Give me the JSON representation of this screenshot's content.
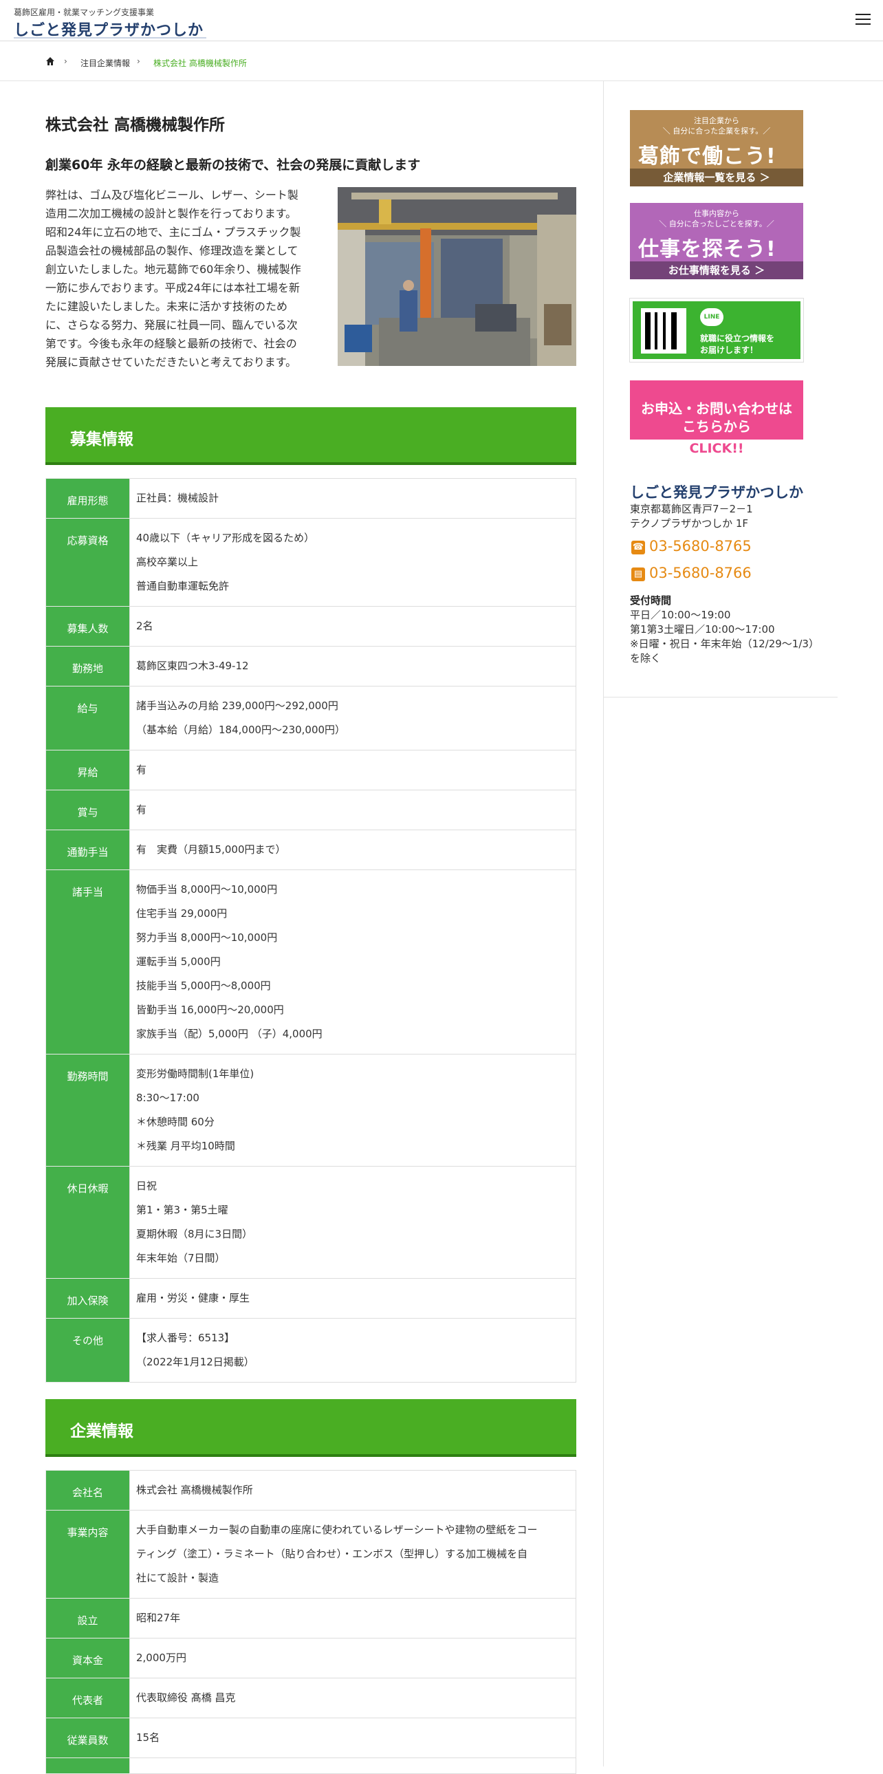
{
  "header": {
    "subtitle": "葛飾区雇用・就業マッチング支援事業",
    "logo": "しごと発見プラザかつしか"
  },
  "breadcrumb": {
    "items": [
      "注目企業情報"
    ],
    "current": "株式会社 高橋機械製作所"
  },
  "company": {
    "title": "株式会社 高橋機械製作所",
    "lead": "創業60年 永年の経験と最新の技術で、社会の発展に貢献します",
    "intro_lines": [
      "弊社は、ゴム及び塩化ビニール、レザー、シート製",
      "造用二次加工機械の設計と製作を行っております。",
      "昭和24年に立石の地で、主にゴム・プラスチック製",
      "品製造会社の機械部品の製作、修理改造を業として",
      "創立いたしました。地元葛飾で60年余り、機械製作",
      "一筋に歩んでおります。平成24年には本社工場を新",
      "たに建設いたしました。未来に活かす技術のため",
      "に、さらなる努力、発展に社員一同、臨んでいる次",
      "第です。今後も永年の経験と最新の技術で、社会の",
      "発展に貢献させていただきたいと考えております。"
    ]
  },
  "recruit": {
    "heading": "募集情報",
    "rows": [
      {
        "label": "雇用形態",
        "lines": [
          "正社員：機械設計"
        ]
      },
      {
        "label": "応募資格",
        "lines": [
          "40歳以下（キャリア形成を図るため）",
          "高校卒業以上",
          "普通自動車運転免許"
        ]
      },
      {
        "label": "募集人数",
        "lines": [
          "2名"
        ]
      },
      {
        "label": "勤務地",
        "lines": [
          "葛飾区東四つ木3-49-12"
        ]
      },
      {
        "label": "給与",
        "lines": [
          "諸手当込みの月給 239,000円～292,000円",
          "（基本給（月給）184,000円～230,000円）"
        ]
      },
      {
        "label": "昇給",
        "lines": [
          "有"
        ]
      },
      {
        "label": "賞与",
        "lines": [
          "有"
        ]
      },
      {
        "label": "通勤手当",
        "lines": [
          "有　実費（月額15,000円まで）"
        ]
      },
      {
        "label": "諸手当",
        "lines": [
          "物価手当 8,000円～10,000円",
          "住宅手当 29,000円",
          "努力手当 8,000円～10,000円",
          "運転手当 5,000円",
          "技能手当 5,000円～8,000円",
          "皆勤手当 16,000円～20,000円",
          "家族手当（配）5,000円 （子）4,000円"
        ]
      },
      {
        "label": "勤務時間",
        "lines": [
          "変形労働時間制(1年単位)",
          "8:30～17:00",
          "＊休憩時間 60分",
          "＊残業 月平均10時間"
        ]
      },
      {
        "label": "休日休暇",
        "lines": [
          "日祝",
          "第1・第3・第5土曜",
          "夏期休暇（8月に3日間）",
          "年末年始（7日間）"
        ]
      },
      {
        "label": "加入保険",
        "lines": [
          "雇用・労災・健康・厚生"
        ]
      },
      {
        "label": "その他",
        "lines": [
          "【求人番号：6513】",
          "（2022年1月12日掲載）"
        ]
      }
    ]
  },
  "corporate": {
    "heading": "企業情報",
    "rows": [
      {
        "label": "会社名",
        "lines": [
          "株式会社 高橋機械製作所"
        ]
      },
      {
        "label": "事業内容",
        "lines": [
          "大手自動車メーカー製の自動車の座席に使われているレザーシートや建物の壁紙をコー",
          "ティング（塗工）・ラミネート（貼り合わせ）・エンボス（型押し）する加工機械を自",
          "社にて設計・製造"
        ]
      },
      {
        "label": "設立",
        "lines": [
          "昭和27年"
        ]
      },
      {
        "label": "資本金",
        "lines": [
          "2,000万円"
        ]
      },
      {
        "label": "代表者",
        "lines": [
          "代表取締役 髙橋 昌克"
        ]
      },
      {
        "label": "従業員数",
        "lines": [
          "15名"
        ]
      },
      {
        "label": "",
        "lines": [
          ""
        ]
      }
    ]
  },
  "sidebar": {
    "banner_kacho": {
      "sub1": "注目企業から",
      "sub2": "＼ 自分に合った企業を探す。／",
      "main": "葛飾で働こう!",
      "bottom": "企業情報一覧を見る ＞"
    },
    "banner_shigoto": {
      "sub1": "仕事内容から",
      "sub2": "＼ 自分に合ったしごとを探す。／",
      "main": "仕事を探そう!",
      "bottom": "お仕事情報を見る ＞"
    },
    "banner_line": {
      "badge": "LINE",
      "text1": "就職に役立つ情報を",
      "text2": "お届けします！"
    },
    "banner_contact": {
      "line1": "お申込・お問い合わせは",
      "line2": "こちらから",
      "click": "CLICK!!"
    },
    "org_name": "しごと発見プラザかつしか",
    "address1": "東京都葛飾区青戸7－2－1",
    "address2": "テクノプラザかつしか 1F",
    "tel": "03-5680-8765",
    "fax": "03-5680-8766",
    "hours_label": "受付時間",
    "hours1": "平日／10:00～19:00",
    "hours2": "第1第3土曜日／10:00～17:00",
    "hours3": "※日曜・祝日・年末年始（12/29～1/3）を除く"
  },
  "colors": {
    "accent": "#4aae23",
    "table_header": "#44b04a",
    "brand_navy": "#24406e",
    "phone": "#e68a13"
  }
}
